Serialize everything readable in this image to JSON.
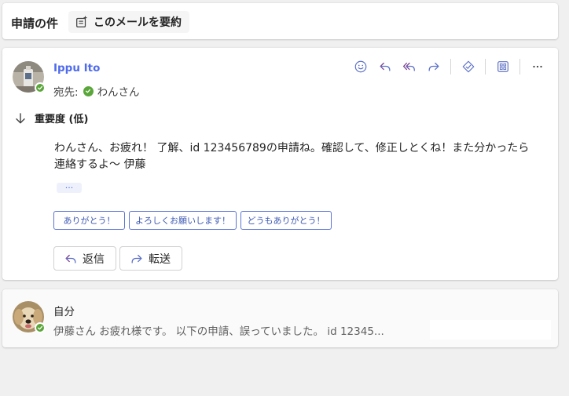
{
  "subject": {
    "title": "申請の件",
    "summarize_label": "このメールを要約"
  },
  "message": {
    "sender_name": "Ippu Ito",
    "to_label": "宛先:",
    "recipient": "わんさん",
    "importance_label": "重要度 (低)",
    "body": "わんさん、お疲れ！ 了解、id 123456789の申請ね。確認して、修正しとくね！また分かったら連絡するよ〜 伊藤",
    "ellipsis": "···",
    "quick_replies": [
      "ありがとう！",
      "よろしくお願いします！",
      "どうもありがとう！"
    ],
    "reply_label": "返信",
    "forward_label": "転送",
    "toolbar_icons": [
      "emoji-icon",
      "reply-icon",
      "reply-all-icon",
      "forward-icon",
      "sticker-icon",
      "apps-icon",
      "more-icon"
    ]
  },
  "collapsed_message": {
    "sender_name": "自分",
    "preview": "伊藤さん お疲れ様です。 以下の申請、誤っていました。 id 12345..."
  },
  "colors": {
    "accent": "#4f6bed",
    "presence_available": "#5ba63b",
    "background": "#f0f0f0"
  }
}
